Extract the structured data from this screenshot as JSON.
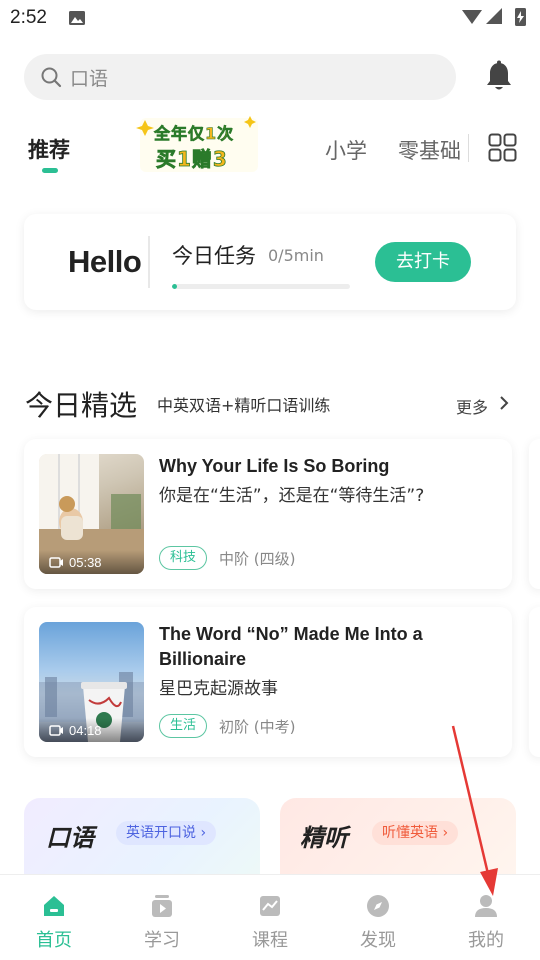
{
  "status_bar": {
    "time": "2:52"
  },
  "search": {
    "placeholder": "口语"
  },
  "tabs": {
    "recommend": "推荐",
    "promo_line1": "全年仅1次",
    "promo_line2": "买1赠3",
    "primary": "小学",
    "zero_basics": "零基础"
  },
  "task_card": {
    "greeting": "Hello",
    "title": "今日任务",
    "progress_text": "0/5min",
    "progress_fraction": 0.0,
    "checkin_label": "去打卡"
  },
  "section": {
    "title": "今日精选",
    "subtitle": "中英双语+精听口语训练",
    "more_label": "更多"
  },
  "articles": [
    {
      "title": "Why Your Life Is So Boring",
      "subtitle": "你是在“生活”，还是在“等待生活”?",
      "duration": "05:38",
      "tag": "科技",
      "level": "中阶 (四级)"
    },
    {
      "title": "The Word “No” Made Me Into a Billionaire",
      "subtitle": "星巴克起源故事",
      "duration": "04:18",
      "tag": "生活",
      "level": "初阶 (中考)"
    }
  ],
  "feature_cards": [
    {
      "title": "口语",
      "badge": "英语开口说 ›"
    },
    {
      "title": "精听",
      "badge": "听懂英语 ›"
    }
  ],
  "bottom_nav": [
    {
      "label": "首页",
      "icon": "home-icon",
      "active": true
    },
    {
      "label": "学习",
      "icon": "study-icon",
      "active": false
    },
    {
      "label": "课程",
      "icon": "course-icon",
      "active": false
    },
    {
      "label": "发现",
      "icon": "compass-icon",
      "active": false
    },
    {
      "label": "我的",
      "icon": "profile-icon",
      "active": false
    }
  ],
  "colors": {
    "accent": "#2bbf94",
    "annotation_arrow": "#e53935"
  }
}
